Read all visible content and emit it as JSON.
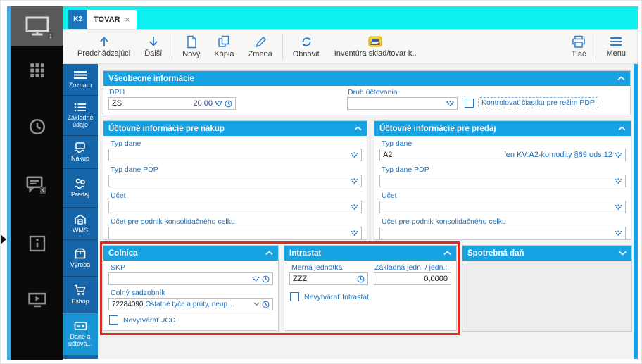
{
  "colors": {
    "cyan_bar": "#0df0f0",
    "panel_header": "#17a2e4",
    "nav_rail": "#1565a8",
    "nav_active": "#1996d6",
    "label_blue": "#1f6fb5",
    "icon_blue": "#2e7ecb",
    "annotation_red": "#e02b20",
    "tab_blue": "#1b75bc"
  },
  "tabs": {
    "k2": "K2",
    "tovar": "TOVAR",
    "close": "×"
  },
  "sidebar": {
    "monitor_badge": "1",
    "chat_badge": "x"
  },
  "toolbar": {
    "items": [
      {
        "label": "Predchádzajúci"
      },
      {
        "label": "Ďalší"
      },
      {
        "label": "Nový"
      },
      {
        "label": "Kópia"
      },
      {
        "label": "Zmena"
      },
      {
        "label": "Obnoviť"
      },
      {
        "label": "Inventúra sklad/tovar k.."
      }
    ],
    "print_label": "Tlač",
    "menu_label": "Menu"
  },
  "nav": {
    "items": [
      {
        "label": "Zoznam"
      },
      {
        "label": "Základné údaje"
      },
      {
        "label": "Nákup"
      },
      {
        "label": "Predaj"
      },
      {
        "label": "WMS"
      },
      {
        "label": "Výroba"
      },
      {
        "label": "Eshop"
      },
      {
        "label": "Dane a účtova..."
      }
    ]
  },
  "panels": {
    "vseobecne": {
      "title": "Všeobecné informácie",
      "dph_label": "DPH",
      "dph_value": "ZS",
      "dph_rate": "20,00",
      "druh_label": "Druh účtovania",
      "druh_value": "",
      "pdp_checkbox_label": "Kontrolovať čiastku pre režim PDP"
    },
    "nakup": {
      "title": "Účtovné informácie pre nákup",
      "fields": [
        {
          "label": "Typ dane",
          "value": ""
        },
        {
          "label": "Typ dane PDP",
          "value": ""
        },
        {
          "label": "Účet",
          "value": ""
        },
        {
          "label": "Účet pre podnik konsolidačného celku",
          "value": ""
        }
      ]
    },
    "predaj": {
      "title": "Účtovné informácie pre predaj",
      "fields": [
        {
          "label": "Typ dane",
          "value": "A2",
          "hint": "len KV:A2-komodity §69 ods.12"
        },
        {
          "label": "Typ dane PDP",
          "value": ""
        },
        {
          "label": "Účet",
          "value": ""
        },
        {
          "label": "Účet pre podnik konsolidačného celku",
          "value": ""
        }
      ]
    },
    "colnica": {
      "title": "Colnica",
      "skp_label": "SKP",
      "skp_value": "",
      "sadzobnik_label": "Colný sadzobník",
      "sadzobnik_code": "72284090",
      "sadzobnik_desc": "Ostatné tyče a prúty, neuprav...",
      "jcd_checkbox_label": "Nevytvárať JCD"
    },
    "intrastat": {
      "title": "Intrastat",
      "mj_label": "Merná jednotka",
      "mj_value": "ZZZ",
      "zj_label": "Základná jedn. / jedn.:",
      "zj_value": "0,0000",
      "checkbox_label": "Nevytvárať Intrastat"
    },
    "spotrebna": {
      "title": "Spotrebná daň"
    }
  }
}
